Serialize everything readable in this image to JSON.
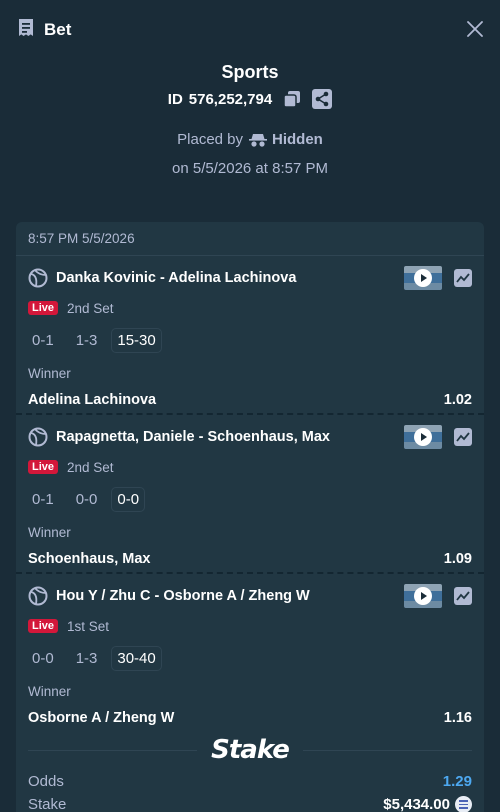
{
  "header": {
    "title": "Bet",
    "receipt_icon": "receipt-icon",
    "close_icon": "close-icon"
  },
  "summary": {
    "sport": "Sports",
    "id_label": "ID",
    "id_value": "576,252,794",
    "placed_by_label": "Placed by",
    "placed_by_user": "Hidden",
    "placed_date": "on 5/5/2026 at 8:57 PM"
  },
  "card": {
    "timestamp": "8:57 PM 5/5/2026",
    "events": [
      {
        "name": "Danka Kovinic - Adelina Lachinova",
        "live_label": "Live",
        "set": "2nd Set",
        "scores": [
          "0-1",
          "1-3"
        ],
        "current_score": "15-30",
        "market": "Winner",
        "selection": "Adelina Lachinova",
        "odds": "1.02"
      },
      {
        "name": "Rapagnetta, Daniele - Schoenhaus, Max",
        "live_label": "Live",
        "set": "2nd Set",
        "scores": [
          "0-1",
          "0-0"
        ],
        "current_score": "0-0",
        "market": "Winner",
        "selection": "Schoenhaus, Max",
        "odds": "1.09"
      },
      {
        "name": "Hou Y / Zhu C - Osborne A / Zheng W",
        "live_label": "Live",
        "set": "1st Set",
        "scores": [
          "0-0",
          "1-3"
        ],
        "current_score": "30-40",
        "market": "Winner",
        "selection": "Osborne A / Zheng W",
        "odds": "1.16"
      }
    ]
  },
  "brand": {
    "logo_text": "Stake"
  },
  "totals": {
    "odds_label": "Odds",
    "odds_value": "1.29",
    "stake_label": "Stake",
    "stake_value": "$5,434.00"
  },
  "colors": {
    "background": "#1a2c38",
    "card": "#213743",
    "live": "#d3173a",
    "odds": "#4da8f0",
    "muted": "#b1bad3"
  }
}
